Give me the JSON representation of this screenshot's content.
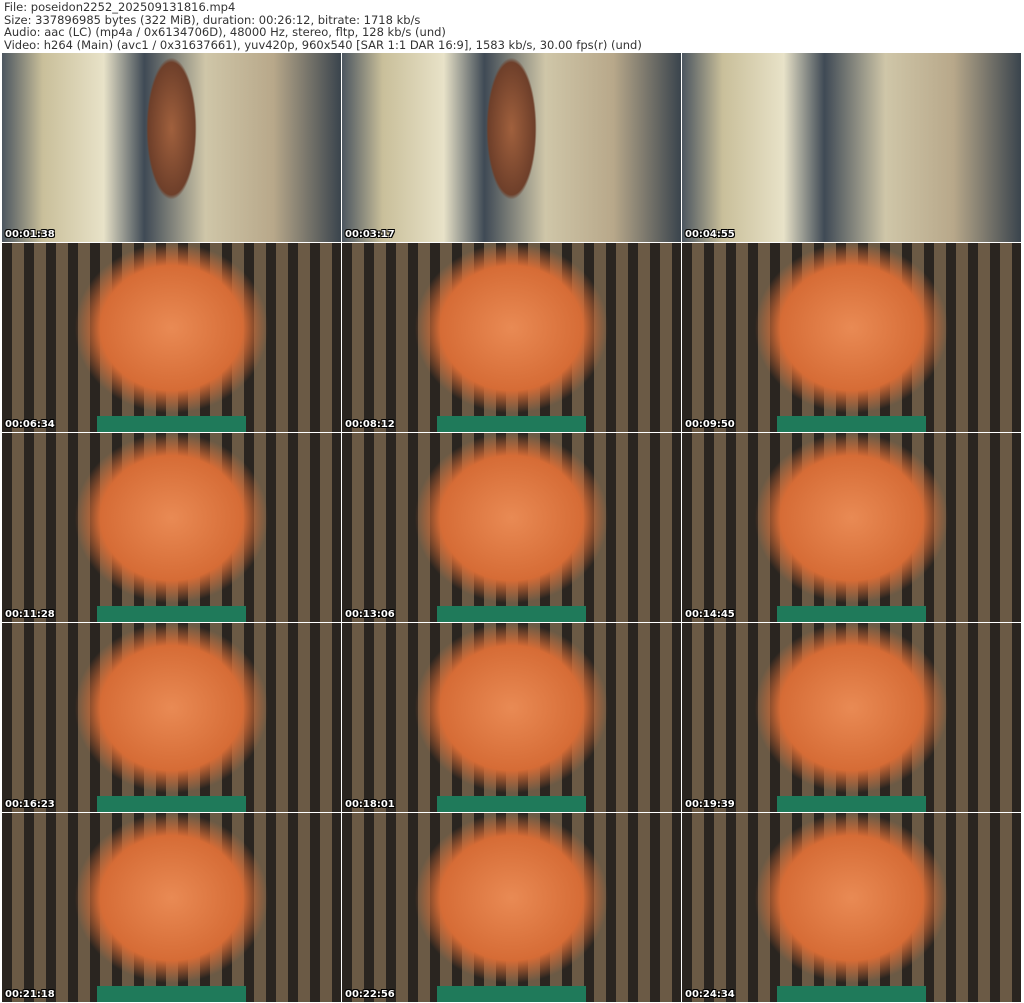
{
  "header": {
    "file": "File: poseidon2252_202509131816.mp4",
    "size": "Size: 337896985 bytes (322 MiB), duration: 00:26:12, bitrate: 1718 kb/s",
    "audio": "Audio: aac (LC) (mp4a / 0x6134706D), 48000 Hz, stereo, fltp, 128 kb/s (und)",
    "video": "Video: h264 (Main) (avc1 / 0x31637661), yuv420p, 960x540 [SAR 1:1 DAR 16:9], 1583 kb/s, 30.00 fps(r) (und)"
  },
  "thumbnails": [
    {
      "time": "00:01:38"
    },
    {
      "time": "00:03:17"
    },
    {
      "time": "00:04:55"
    },
    {
      "time": "00:06:34"
    },
    {
      "time": "00:08:12"
    },
    {
      "time": "00:09:50"
    },
    {
      "time": "00:11:28"
    },
    {
      "time": "00:13:06"
    },
    {
      "time": "00:14:45"
    },
    {
      "time": "00:16:23"
    },
    {
      "time": "00:18:01"
    },
    {
      "time": "00:19:39"
    },
    {
      "time": "00:21:18"
    },
    {
      "time": "00:22:56"
    },
    {
      "time": "00:24:34"
    }
  ]
}
